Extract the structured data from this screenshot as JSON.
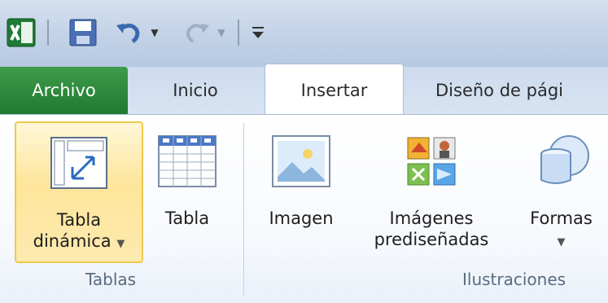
{
  "qat": {
    "app_icon": "excel-icon",
    "save_icon": "save-icon",
    "undo_icon": "undo-icon",
    "redo_icon": "redo-icon",
    "customize_icon": "customize-qat-icon"
  },
  "tabs": [
    {
      "label": "Archivo"
    },
    {
      "label": "Inicio"
    },
    {
      "label": "Insertar"
    },
    {
      "label": "Diseño de pági"
    }
  ],
  "groups": {
    "tablas": {
      "label": "Tablas",
      "pivot": {
        "line1": "Tabla",
        "line2": "dinámica",
        "icon": "pivot-table-icon"
      },
      "table": {
        "label": "Tabla",
        "icon": "table-icon"
      }
    },
    "ilustraciones": {
      "label": "Ilustraciones",
      "image": {
        "label": "Imagen",
        "icon": "picture-icon"
      },
      "clipart": {
        "line1": "Imágenes",
        "line2": "prediseñadas",
        "icon": "clip-art-icon"
      },
      "shapes": {
        "label": "Formas",
        "icon": "shapes-icon"
      }
    }
  },
  "colors": {
    "file_tab": "#2a8a38",
    "selected_button_border": "#efc94d",
    "ribbon_bg": "#ffffff",
    "group_label": "#5a6b80"
  }
}
